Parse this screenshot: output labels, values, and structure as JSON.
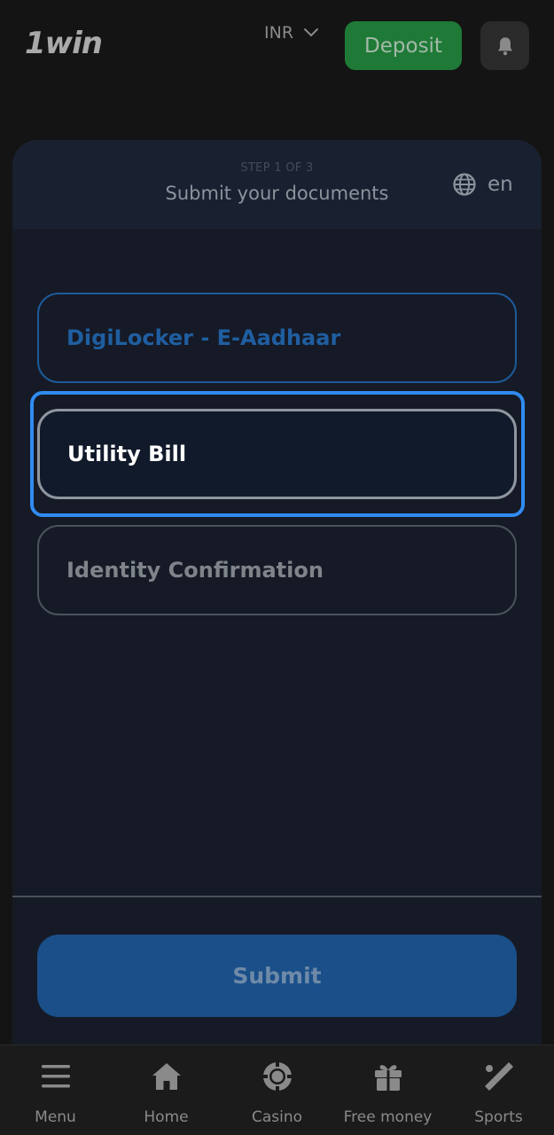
{
  "header": {
    "logo_text": "1win",
    "currency": "INR",
    "deposit_label": "Deposit"
  },
  "card": {
    "step_text": "STEP 1 OF 3",
    "title": "Submit your documents",
    "language": "en",
    "options": [
      {
        "label": "DigiLocker - E-Aadhaar"
      },
      {
        "label": "Utility Bill"
      },
      {
        "label": "Identity Confirmation"
      }
    ],
    "submit_label": "Submit"
  },
  "bottom_nav": {
    "items": [
      {
        "label": "Menu",
        "icon": "menu-icon"
      },
      {
        "label": "Home",
        "icon": "home-icon"
      },
      {
        "label": "Casino",
        "icon": "casino-chip-icon"
      },
      {
        "label": "Free money",
        "icon": "gift-icon"
      },
      {
        "label": "Sports",
        "icon": "sports-icon"
      }
    ]
  },
  "colors": {
    "background": "#141414",
    "card": "#151a26",
    "deposit_green": "#1f7a37",
    "submit_blue": "#1a4f89",
    "highlight_blue": "#2f8bf0",
    "option_blue_text": "#1f5ea0"
  }
}
